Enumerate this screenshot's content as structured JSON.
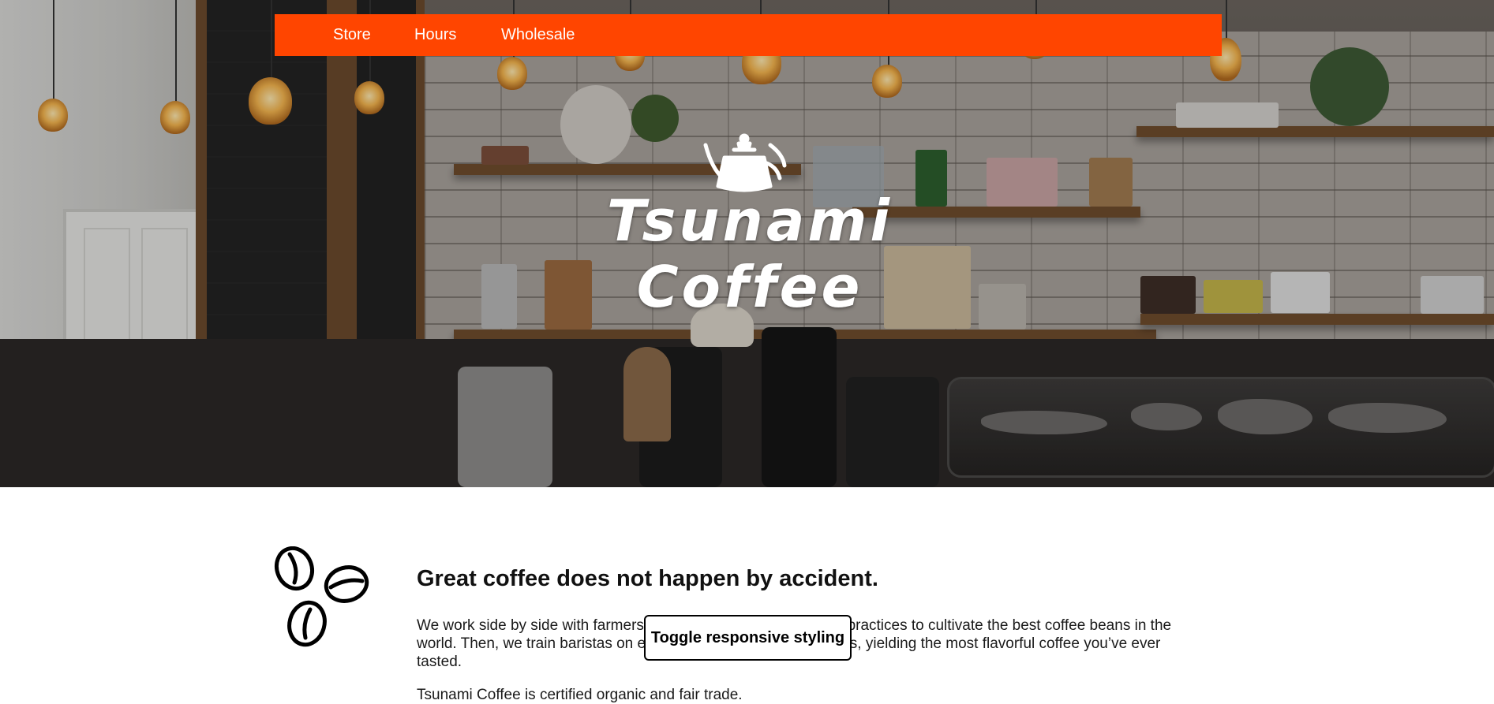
{
  "nav": {
    "items": [
      {
        "label": "Store"
      },
      {
        "label": "Hours"
      },
      {
        "label": "Wholesale"
      }
    ],
    "background_color": "#ff4500"
  },
  "hero": {
    "logo_icon": "kettle-icon",
    "brand_line1": "Tsunami",
    "brand_line2": "Coffee"
  },
  "intro": {
    "icon": "coffee-beans-icon",
    "headline": "Great coffee does not happen by accident.",
    "body": "We work side by side with farmers to implement modern farming practices to cultivate the best coffee beans in the world. Then, we train baristas on every aspect of the brew process, yielding the most flavorful coffee you’ve ever tasted.",
    "certification": "Tsunami Coffee is certified organic and fair trade."
  },
  "toggle": {
    "label": "Toggle responsive styling"
  }
}
